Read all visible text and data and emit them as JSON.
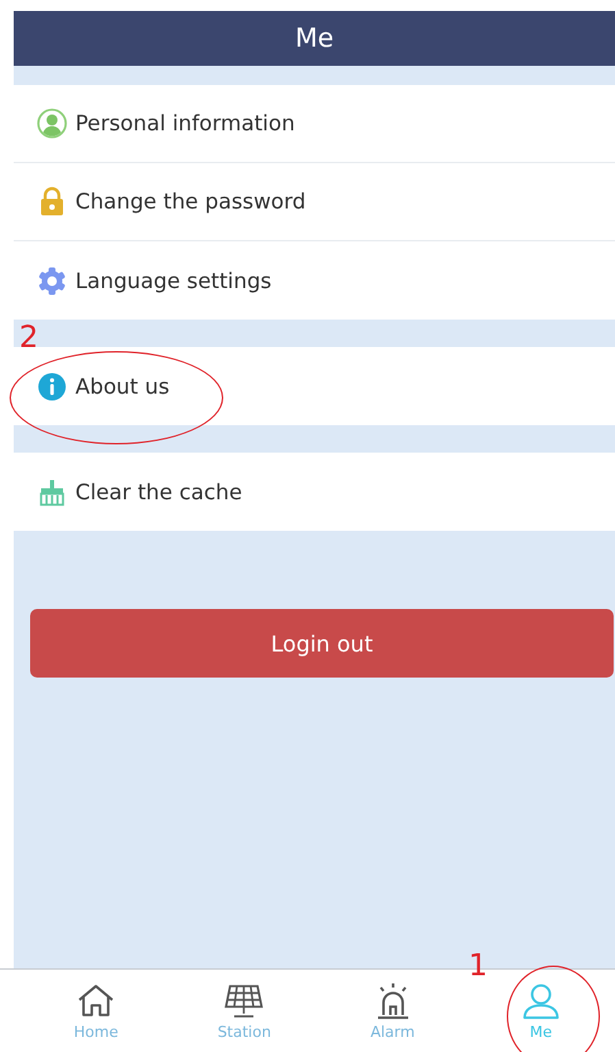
{
  "header": {
    "title": "Me"
  },
  "menu_groups": [
    {
      "items": [
        {
          "kind": "person",
          "label": "Personal information"
        },
        {
          "kind": "lock",
          "label": "Change the password"
        },
        {
          "kind": "gear",
          "label": "Language settings"
        }
      ]
    },
    {
      "items": [
        {
          "kind": "info",
          "label": "About us"
        }
      ]
    },
    {
      "items": [
        {
          "kind": "broom",
          "label": "Clear the cache"
        }
      ]
    }
  ],
  "logout_button": {
    "label": "Login out"
  },
  "tab_bar": [
    {
      "kind": "home",
      "label": "Home",
      "selected": false
    },
    {
      "kind": "station",
      "label": "Station",
      "selected": false
    },
    {
      "kind": "alarm",
      "label": "Alarm",
      "selected": false
    },
    {
      "kind": "me",
      "label": "Me",
      "selected": true
    }
  ],
  "annotations": [
    {
      "kind": "row",
      "label": "2"
    },
    {
      "kind": "tab",
      "label": "1"
    }
  ]
}
